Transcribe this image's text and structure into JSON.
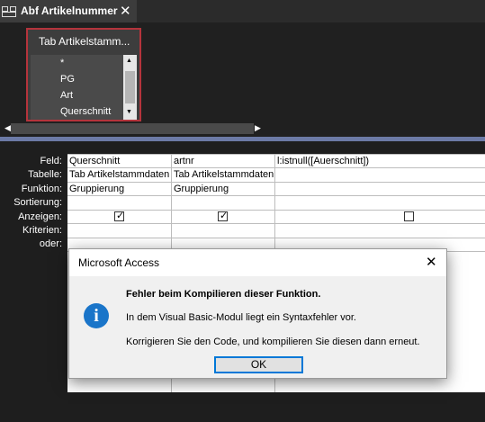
{
  "tab": {
    "title": "Abf Artikelnummer",
    "close_glyph": "✕",
    "icon": "query-icon"
  },
  "table_box": {
    "title": "Tab Artikelstamm...",
    "fields": [
      "*",
      "PG",
      "Art",
      "Querschnitt"
    ]
  },
  "grid": {
    "row_labels": [
      "Feld:",
      "Tabelle:",
      "Funktion:",
      "Sortierung:",
      "Anzeigen:",
      "Kriterien:",
      "oder:"
    ],
    "columns": [
      {
        "feld": "Querschnitt",
        "tabelle": "Tab Artikelstammdaten",
        "funktion": "Gruppierung",
        "anzeigen": true
      },
      {
        "feld": "artnr",
        "tabelle": "Tab Artikelstammdaten",
        "funktion": "Gruppierung",
        "anzeigen": true
      },
      {
        "feld": "l:istnull([Auerschnitt])",
        "tabelle": "",
        "funktion": "",
        "anzeigen": false
      }
    ]
  },
  "dialog": {
    "title": "Microsoft Access",
    "close_glyph": "✕",
    "heading": "Fehler beim Kompilieren dieser Funktion.",
    "line1": "In dem Visual Basic-Modul liegt ein Syntaxfehler vor.",
    "line2": "Korrigieren Sie den Code, und kompilieren Sie diesen dann erneut.",
    "ok_label": "OK",
    "icon": "info-icon",
    "icon_glyph": "i"
  },
  "colors": {
    "accent_border": "#b5343c",
    "divider": "#6c7aa6",
    "info_blue": "#1a75c9",
    "ok_focus": "#0078d7"
  }
}
